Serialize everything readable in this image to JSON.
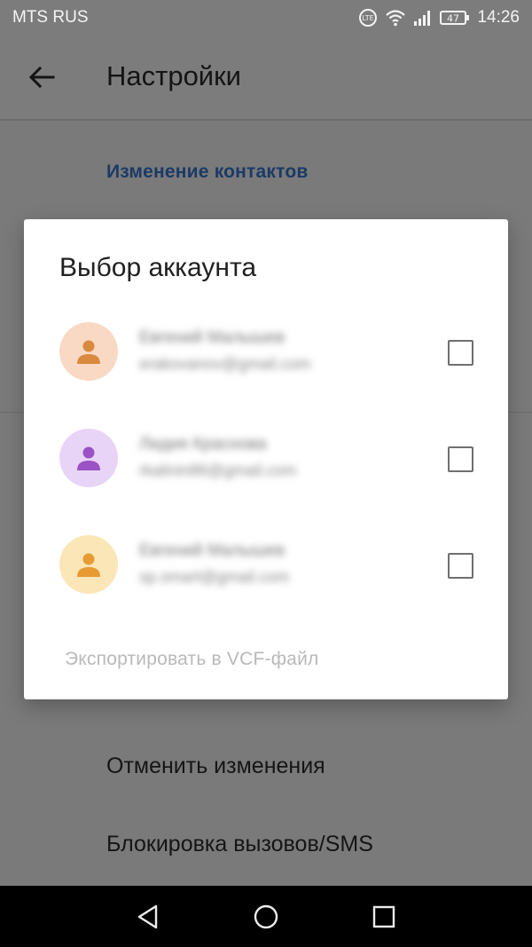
{
  "status_bar": {
    "carrier": "MTS RUS",
    "time": "14:26",
    "battery": "47",
    "lte_badge": "LTE"
  },
  "app_bar": {
    "title": "Настройки",
    "back_icon": "arrow-left-icon"
  },
  "settings": {
    "section_header": "Изменение контактов",
    "items": [
      "Отменить изменения",
      "Блокировка вызовов/SMS"
    ]
  },
  "dialog": {
    "title": "Выбор аккаунта",
    "accounts": [
      {
        "name": "Евгений Малышев",
        "email": "erakovanov@gmail.com",
        "avatar_bg": "#f9d9c4",
        "avatar_fg": "#d98a3f",
        "checked": false
      },
      {
        "name": "Лидия Краснова",
        "email": "rkalinin86@gmail.com",
        "avatar_bg": "#e8d4f6",
        "avatar_fg": "#9a52c4",
        "checked": false
      },
      {
        "name": "Евгений Малышев",
        "email": "sp.smart@gmail.com",
        "avatar_bg": "#fbe6b7",
        "avatar_fg": "#e79b32",
        "checked": false
      }
    ],
    "export_label": "Экспортировать в VCF-файл"
  },
  "nav_bar": {
    "back": "triangle-back-icon",
    "home": "circle-home-icon",
    "recents": "square-recents-icon"
  },
  "colors": {
    "accent": "#1b3a66",
    "dim_background": "#7a7a7a",
    "dialog_background": "#ffffff"
  }
}
